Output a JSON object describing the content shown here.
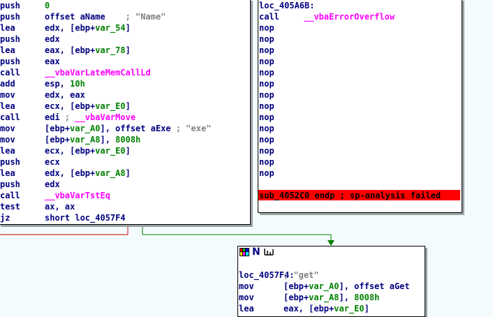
{
  "colors": {
    "background": "#f3fbfd",
    "mnemonic": "#000080",
    "import_call": "#ff00ff",
    "stack_var": "#008000",
    "comment": "#808080",
    "error_bg": "#ff0000",
    "edge_false": "#cc0000",
    "edge_true": "#008000"
  },
  "left_block": {
    "lines": [
      [
        {
          "t": "push",
          "c": "mn"
        },
        {
          "t": "0",
          "c": "green"
        }
      ],
      [
        {
          "t": "push",
          "c": "mn"
        },
        {
          "t": "offset aName    ",
          "c": "navy"
        },
        {
          "t": "; \"Name\"",
          "c": "gray"
        }
      ],
      [
        {
          "t": "lea",
          "c": "mn"
        },
        {
          "t": "edx, [ebp+",
          "c": "navy"
        },
        {
          "t": "var_54",
          "c": "green"
        },
        {
          "t": "]",
          "c": "navy"
        }
      ],
      [
        {
          "t": "push",
          "c": "mn"
        },
        {
          "t": "edx",
          "c": "navy"
        }
      ],
      [
        {
          "t": "lea",
          "c": "mn"
        },
        {
          "t": "eax, [ebp+",
          "c": "navy"
        },
        {
          "t": "var_78",
          "c": "green"
        },
        {
          "t": "]",
          "c": "navy"
        }
      ],
      [
        {
          "t": "push",
          "c": "mn"
        },
        {
          "t": "eax",
          "c": "navy"
        }
      ],
      [
        {
          "t": "call",
          "c": "mn"
        },
        {
          "t": "__vbaVarLateMemCallLd",
          "c": "pink"
        }
      ],
      [
        {
          "t": "add",
          "c": "mn"
        },
        {
          "t": "esp, ",
          "c": "navy"
        },
        {
          "t": "10h",
          "c": "green"
        }
      ],
      [
        {
          "t": "mov",
          "c": "mn"
        },
        {
          "t": "edx, eax",
          "c": "navy"
        }
      ],
      [
        {
          "t": "lea",
          "c": "mn"
        },
        {
          "t": "ecx, [ebp+",
          "c": "navy"
        },
        {
          "t": "var_E0",
          "c": "green"
        },
        {
          "t": "]",
          "c": "navy"
        }
      ],
      [
        {
          "t": "call",
          "c": "mn"
        },
        {
          "t": "edi ",
          "c": "navy"
        },
        {
          "t": "; ",
          "c": "gray"
        },
        {
          "t": "__vbaVarMove",
          "c": "pink"
        }
      ],
      [
        {
          "t": "mov",
          "c": "mn"
        },
        {
          "t": "[ebp+",
          "c": "navy"
        },
        {
          "t": "var_A0",
          "c": "green"
        },
        {
          "t": "], offset aExe ",
          "c": "navy"
        },
        {
          "t": "; \"exe\"",
          "c": "gray"
        }
      ],
      [
        {
          "t": "mov",
          "c": "mn"
        },
        {
          "t": "[ebp+",
          "c": "navy"
        },
        {
          "t": "var_A8",
          "c": "green"
        },
        {
          "t": "], ",
          "c": "navy"
        },
        {
          "t": "8008h",
          "c": "green"
        }
      ],
      [
        {
          "t": "lea",
          "c": "mn"
        },
        {
          "t": "ecx, [ebp+",
          "c": "navy"
        },
        {
          "t": "var_E0",
          "c": "green"
        },
        {
          "t": "]",
          "c": "navy"
        }
      ],
      [
        {
          "t": "push",
          "c": "mn"
        },
        {
          "t": "ecx",
          "c": "navy"
        }
      ],
      [
        {
          "t": "lea",
          "c": "mn"
        },
        {
          "t": "edx, [ebp+",
          "c": "navy"
        },
        {
          "t": "var_A8",
          "c": "green"
        },
        {
          "t": "]",
          "c": "navy"
        }
      ],
      [
        {
          "t": "push",
          "c": "mn"
        },
        {
          "t": "edx",
          "c": "navy"
        }
      ],
      [
        {
          "t": "call",
          "c": "mn"
        },
        {
          "t": "__vbaVarTstEq",
          "c": "pink"
        }
      ],
      [
        {
          "t": "test",
          "c": "mn"
        },
        {
          "t": "ax, ax",
          "c": "navy"
        }
      ],
      [
        {
          "t": "jz",
          "c": "mn"
        },
        {
          "t": "short loc_4057F4",
          "c": "navy"
        }
      ]
    ]
  },
  "right_block": {
    "lines": [
      [
        {
          "t": "loc_405A6B:",
          "c": "navy",
          "label": true
        }
      ],
      [
        {
          "t": "call",
          "c": "mn"
        },
        {
          "t": "__vbaErrorOverflow",
          "c": "pink"
        }
      ],
      [
        {
          "t": "nop",
          "c": "mn"
        }
      ],
      [
        {
          "t": "nop",
          "c": "mn"
        }
      ],
      [
        {
          "t": "nop",
          "c": "mn"
        }
      ],
      [
        {
          "t": "nop",
          "c": "mn"
        }
      ],
      [
        {
          "t": "nop",
          "c": "mn"
        }
      ],
      [
        {
          "t": "nop",
          "c": "mn"
        }
      ],
      [
        {
          "t": "nop",
          "c": "mn"
        }
      ],
      [
        {
          "t": "nop",
          "c": "mn"
        }
      ],
      [
        {
          "t": "nop",
          "c": "mn"
        }
      ],
      [
        {
          "t": "nop",
          "c": "mn"
        }
      ],
      [
        {
          "t": "nop",
          "c": "mn"
        }
      ],
      [
        {
          "t": "nop",
          "c": "mn"
        }
      ],
      [
        {
          "t": "nop",
          "c": "mn"
        }
      ],
      [
        {
          "t": "nop",
          "c": "mn"
        }
      ]
    ],
    "error_line": "sub_4052C0 endp ; sp-analysis failed"
  },
  "bottom_block": {
    "header_icons": [
      "color-palette-icon",
      "n-rename-icon",
      "graph-overview-icon"
    ],
    "header_letter": "N",
    "lines": [
      [],
      [
        {
          "t": "loc_4057F4:               ",
          "c": "navy",
          "label": true
        },
        {
          "t": "; \"get\"",
          "c": "gray"
        }
      ],
      [
        {
          "t": "mov",
          "c": "mn"
        },
        {
          "t": "[ebp+",
          "c": "navy"
        },
        {
          "t": "var_A0",
          "c": "green"
        },
        {
          "t": "], offset aGet",
          "c": "navy"
        }
      ],
      [
        {
          "t": "mov",
          "c": "mn"
        },
        {
          "t": "[ebp+",
          "c": "navy"
        },
        {
          "t": "var_A8",
          "c": "green"
        },
        {
          "t": "], ",
          "c": "navy"
        },
        {
          "t": "8008h",
          "c": "green"
        }
      ],
      [
        {
          "t": "lea",
          "c": "mn"
        },
        {
          "t": "eax, [ebp+",
          "c": "navy"
        },
        {
          "t": "var_E0",
          "c": "green"
        },
        {
          "t": "]",
          "c": "navy"
        }
      ]
    ]
  }
}
